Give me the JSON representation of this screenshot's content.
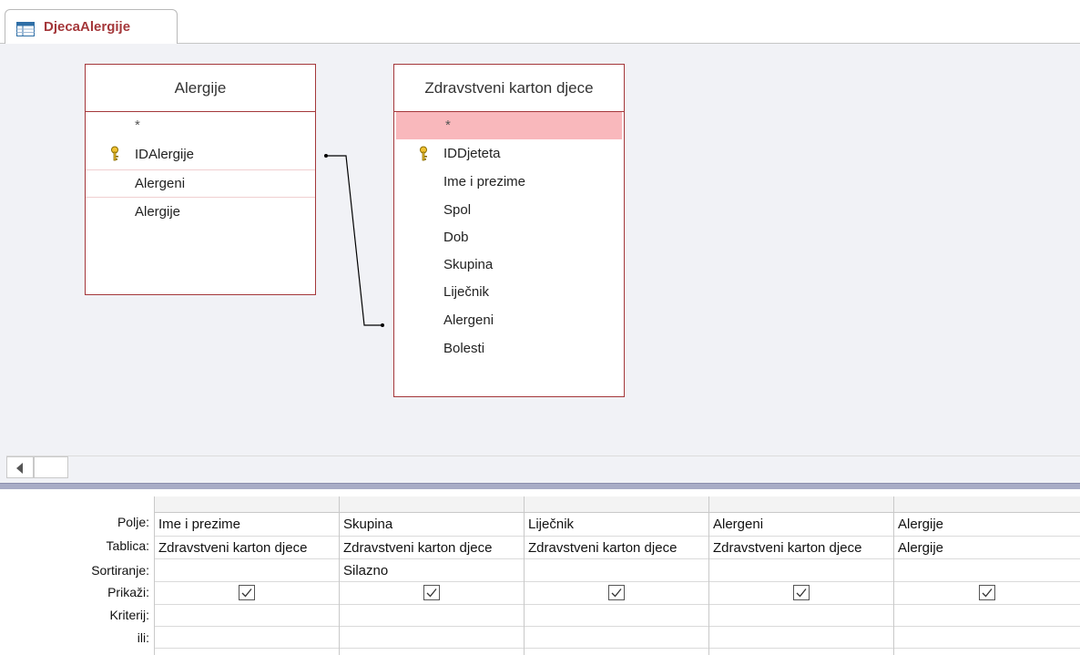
{
  "document_tab": {
    "title": "DjecaAlergije",
    "icon": "query-design-icon"
  },
  "tables": [
    {
      "title": "Alergije",
      "fields": [
        {
          "label": "*",
          "key": false
        },
        {
          "label": "IDAlergije",
          "key": true
        },
        {
          "label": "Alergeni",
          "key": false
        },
        {
          "label": "Alergije",
          "key": false
        }
      ]
    },
    {
      "title": "Zdravstveni karton djece",
      "fields": [
        {
          "label": "*",
          "key": false
        },
        {
          "label": "IDDjeteta",
          "key": true
        },
        {
          "label": "Ime i prezime",
          "key": false
        },
        {
          "label": "Spol",
          "key": false
        },
        {
          "label": "Dob",
          "key": false
        },
        {
          "label": "Skupina",
          "key": false
        },
        {
          "label": "Liječnik",
          "key": false
        },
        {
          "label": "Alergeni",
          "key": false
        },
        {
          "label": "Bolesti",
          "key": false
        }
      ]
    }
  ],
  "grid": {
    "row_labels": [
      "Polje:",
      "Tablica:",
      "Sortiranje:",
      "Prikaži:",
      "Kriterij:",
      "ili:"
    ],
    "columns": [
      {
        "field": "Ime i prezime",
        "table": "Zdravstveni karton djece",
        "sort": "",
        "show": true
      },
      {
        "field": "Skupina",
        "table": "Zdravstveni karton djece",
        "sort": "Silazno",
        "show": true
      },
      {
        "field": "Liječnik",
        "table": "Zdravstveni karton djece",
        "sort": "",
        "show": true
      },
      {
        "field": "Alergeni",
        "table": "Zdravstveni karton djece",
        "sort": "",
        "show": true
      },
      {
        "field": "Alergije",
        "table": "Alergije",
        "sort": "",
        "show": true
      }
    ]
  },
  "colors": {
    "accent": "#a4373a",
    "selected_row": "#f9b8bc",
    "design_bg": "#f1f2f6"
  }
}
